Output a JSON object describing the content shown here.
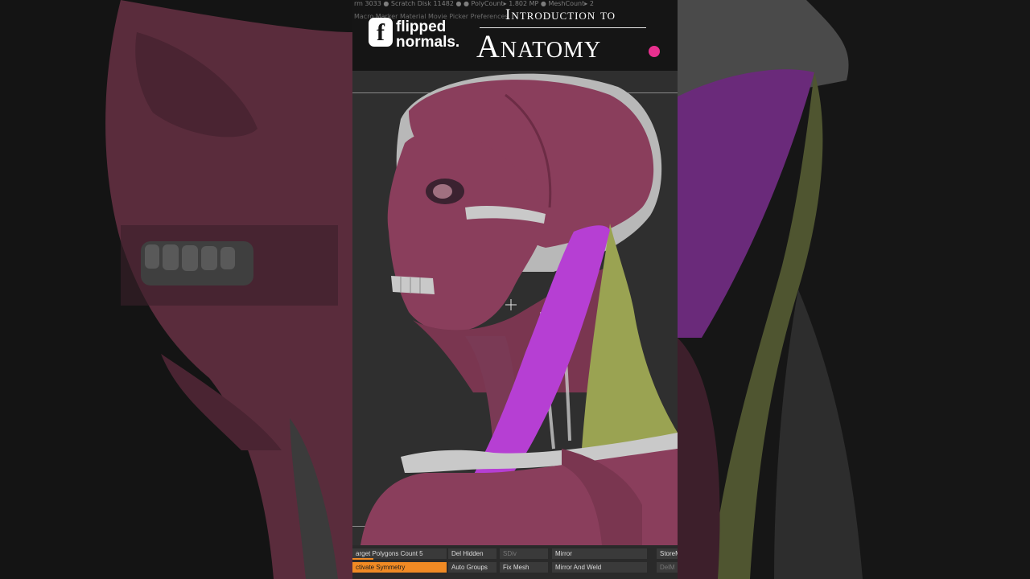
{
  "header": {
    "ztext_status": "rm 3033 ● Scratch Disk 11482 ●  ● PolyCount▸ 1.802 MP  ● MeshCount▸ 2",
    "ztext_menu": "Macro   Marker   Material   Movie   Picker   Preferences",
    "logo_letter": "f",
    "logo_line1": "flipped",
    "logo_line2": "normals.",
    "title_line1": "Introduction to",
    "title_line2": "Anatomy",
    "accent_color": "#e8308f"
  },
  "bottom": {
    "target_polygons": "arget Polygons Count 5",
    "del_hidden": "Del Hidden",
    "sdiv": "SDiv",
    "mirror": "Mirror",
    "store": "StoreM",
    "activate_symmetry": "ctivate Symmetry",
    "auto_groups": "Auto Groups",
    "fix_mesh": "Fix Mesh",
    "mirror_and_weld": "Mirror And Weld",
    "del_m": "DelM"
  },
  "colors": {
    "muscle": "#8a3e5c",
    "highlight_muscle": "#b63fd3",
    "trapezius": "#9aa352",
    "bone": "#c9c9c9",
    "ui_orange": "#f08a24"
  }
}
